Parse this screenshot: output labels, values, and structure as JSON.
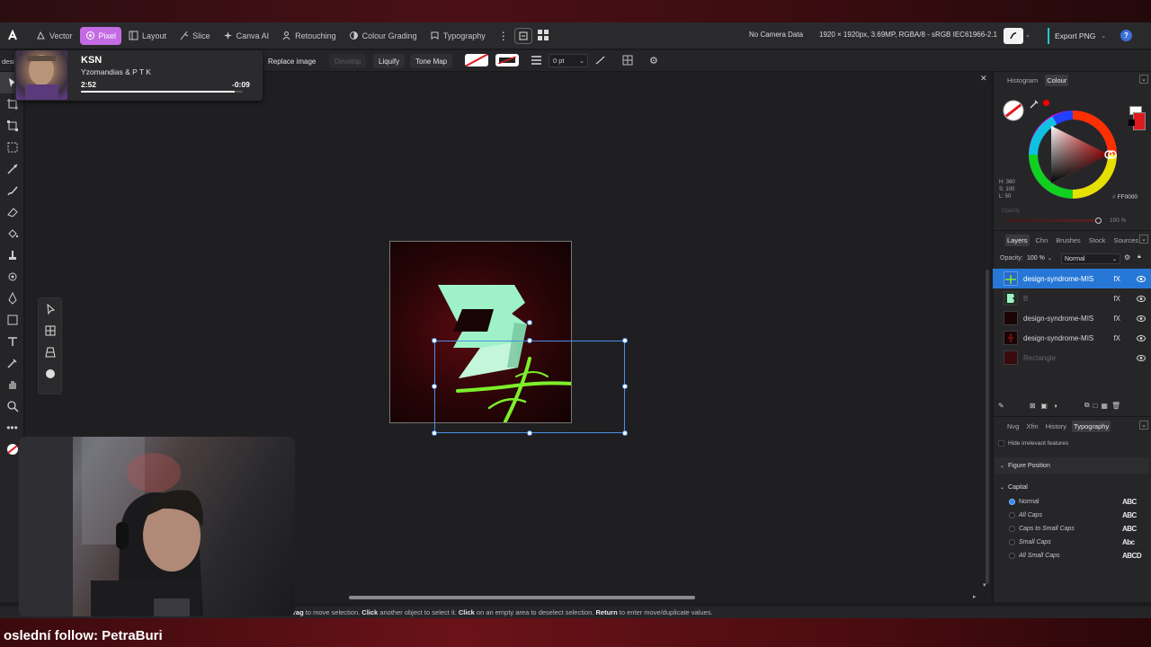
{
  "app": {
    "personas": [
      {
        "label": "Vector",
        "icon": "vector-icon",
        "active": false
      },
      {
        "label": "Pixel",
        "icon": "pixel-icon",
        "active": true
      },
      {
        "label": "Layout",
        "icon": "layout-icon",
        "active": false
      },
      {
        "label": "Slice",
        "icon": "slice-icon",
        "active": false
      },
      {
        "label": "Canva AI",
        "icon": "sparkle-icon",
        "active": false
      },
      {
        "label": "Retouching",
        "icon": "person-icon",
        "active": false
      },
      {
        "label": "Colour Grading",
        "icon": "grading-icon",
        "active": false
      },
      {
        "label": "Typography",
        "icon": "typography-icon",
        "active": false
      }
    ],
    "camera_data": "No Camera Data",
    "document_info": "1920 × 1920px, 3.69MP, RGBA/8 - sRGB IEC61966-2.1",
    "export_label": "Export PNG"
  },
  "context_toolbar": {
    "truncated_doc": "desi",
    "replace_image": "Replace image",
    "develop": "Develop",
    "liquify": "Liquify",
    "tone_map": "Tone Map",
    "stroke_width": "0 pt"
  },
  "music": {
    "title": "KSN",
    "artist": "Yzomandias & P T K",
    "elapsed": "2:52",
    "remaining": "-0:09",
    "progress": 0.95
  },
  "right_panel": {
    "top_tabs": [
      "Histogram",
      "Colour"
    ],
    "top_active": "Colour",
    "hsl": {
      "h": "H: 360",
      "s": "S: 100",
      "l": "L: 50"
    },
    "hex": "FF0000",
    "opacity_label": "Opacity",
    "opacity_value": "100 %",
    "layer_tabs": [
      "Layers",
      "Chn",
      "Brushes",
      "Stock",
      "Sources"
    ],
    "layer_active": "Layers",
    "layer_opacity_label": "Opacity:",
    "layer_opacity": "100 %",
    "blend_mode": "Normal",
    "layers": [
      {
        "name": "design-syndrome-MIS",
        "selected": true,
        "dim": false
      },
      {
        "name": "B",
        "selected": false,
        "dim": true
      },
      {
        "name": "design-syndrome-MIS",
        "selected": false,
        "dim": false
      },
      {
        "name": "design-syndrome-MIS",
        "selected": false,
        "dim": false
      },
      {
        "name": "Rectangle",
        "selected": false,
        "dim": true
      }
    ],
    "bottom_tabs": [
      "Nvg",
      "Xfm",
      "History",
      "Typography"
    ],
    "bottom_active": "Typography",
    "hide_irrelevant": "Hide irrelevant features",
    "figure_position": "Figure Position",
    "capital": "Capital",
    "capital_options": [
      {
        "label": "Normal",
        "on": true,
        "glyph": "ABC"
      },
      {
        "label": "All Caps",
        "on": false,
        "glyph": "ABC"
      },
      {
        "label": "Caps to Small Caps",
        "on": false,
        "glyph": "ABC"
      },
      {
        "label": "Small Caps",
        "on": false,
        "glyph": "Abc"
      },
      {
        "label": "All Small Caps",
        "on": false,
        "glyph": "ABCD"
      }
    ]
  },
  "status": {
    "drag_word": "rag",
    "drag_rest": " to move selection. ",
    "click_word": "Click",
    "click_rest": " another object to select it. ",
    "click2_word": "Click",
    "click2_rest": " on an empty area to deselect selection. ",
    "return_word": "Return",
    "return_rest": " to enter move/duplicate values."
  },
  "stream": {
    "follow_text": "oslední follow: PetraBuri"
  },
  "colors": {
    "accent_persona": "#c46be3",
    "selection_blue": "#2778d6",
    "hex_red": "#ff0000",
    "logo_mint": "#9ff2c8",
    "logo_green": "#7cf02a"
  }
}
